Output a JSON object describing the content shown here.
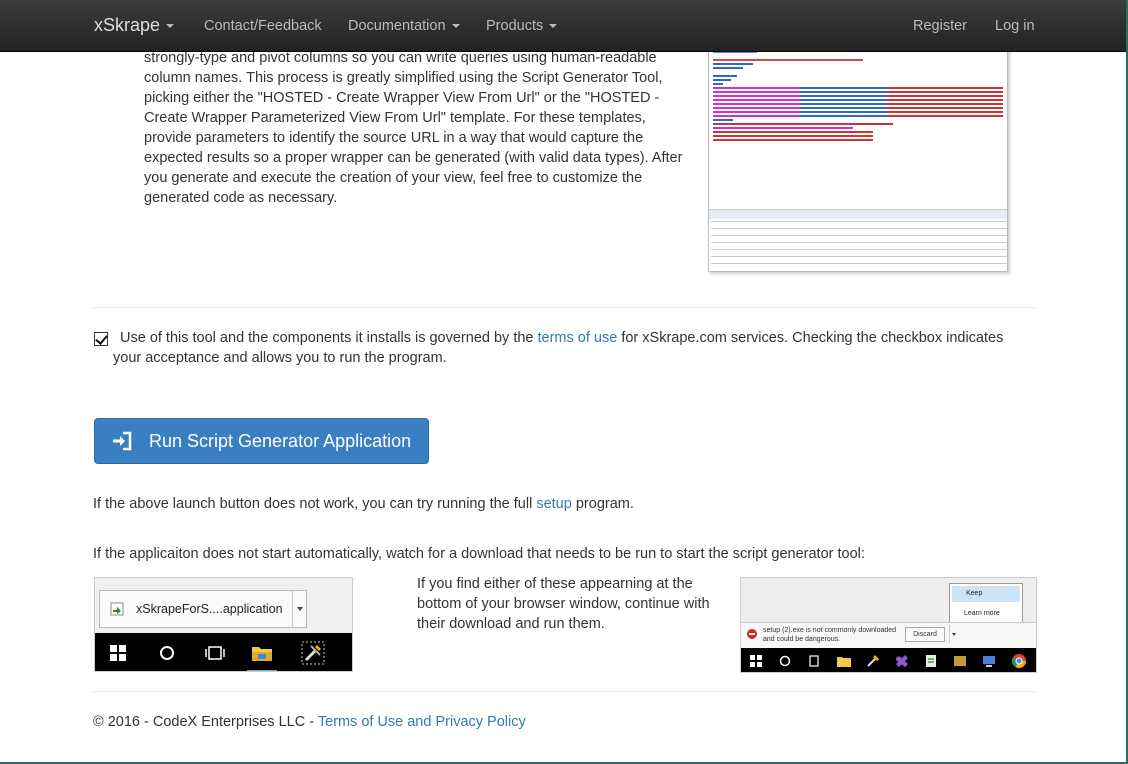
{
  "navbar": {
    "brand": "xSkrape",
    "items": [
      {
        "label": "Contact/Feedback"
      },
      {
        "label": "Documentation"
      },
      {
        "label": "Products"
      }
    ],
    "right": [
      {
        "label": "Register"
      },
      {
        "label": "Log in"
      }
    ]
  },
  "intro": {
    "text": "strongly-type and pivot columns so you can write queries using human-readable column names. This process is greatly simplified using the Script Generator Tool, picking either the \"HOSTED - Create Wrapper View From Url\" or the \"HOSTED - Create Wrapper Parameterized View From Url\" template. For these templates, provide parameters to identify the source URL in a way that would capture the expected results so a proper wrapper can be generated (with valid data types). After you generate and execute the creation of your view, feel free to customize the generated code as necessary."
  },
  "terms": {
    "checked": true,
    "before": "Use of this tool and the components it installs is governed by the ",
    "link": "terms of use",
    "after": " for xSkrape.com services. Checking the checkbox indicates your acceptance and allows you to run the program."
  },
  "run_button": {
    "label": "Run Script Generator Application"
  },
  "setup_para": {
    "before": "If the above launch button does not work, you can try running the full ",
    "link": "setup",
    "after": " program."
  },
  "auto_para": {
    "text": "If the applicaiton does not start automatically, watch for a download that needs to be run to start the script generator tool:"
  },
  "download_shot": {
    "filename": "xSkrapeForS....application"
  },
  "mid_text": {
    "text": "If you find either of these appearning at the bottom of your browser window, continue with their download and run them."
  },
  "chrome_shot": {
    "menu_keep": "Keep",
    "menu_learn": "Learn more",
    "warning": "setup (2).exe is not commonly downloaded and could be dangerous.",
    "discard": "Discard"
  },
  "footer": {
    "copyright": "© 2016 - CodeX Enterprises LLC - ",
    "link": "Terms of Use and Privacy Policy"
  },
  "colors": {
    "primary": "#3a7fc1",
    "link": "#337ab7",
    "navbar": "#222222"
  }
}
